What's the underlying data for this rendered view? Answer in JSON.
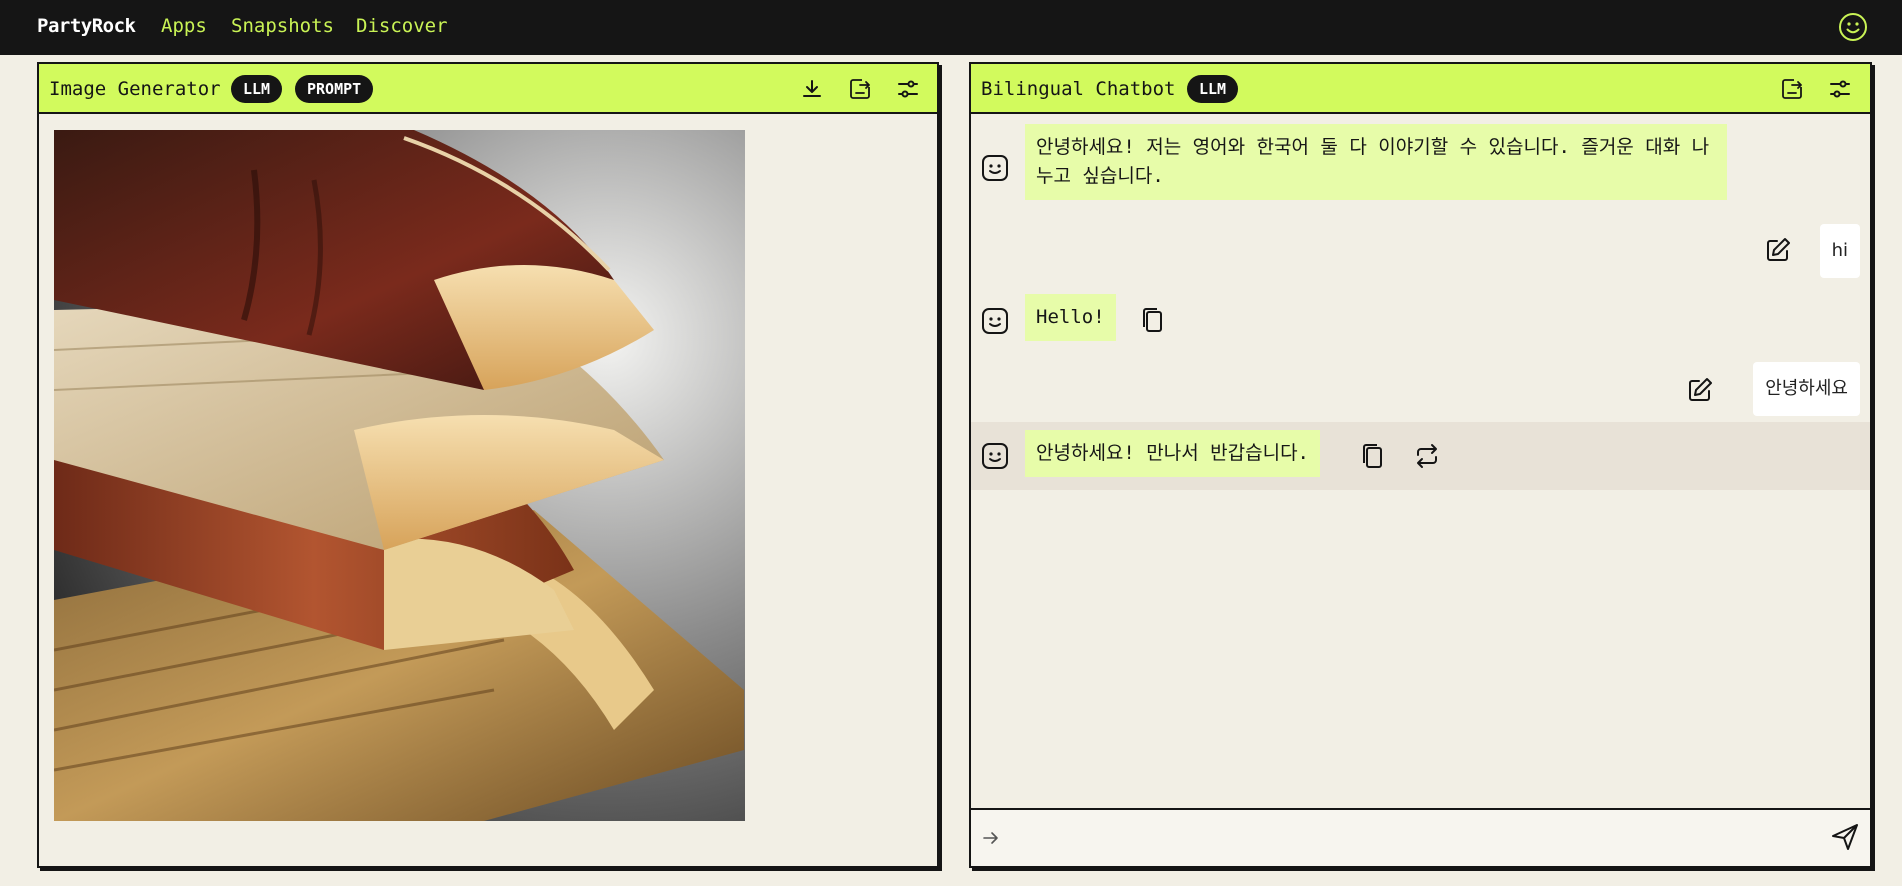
{
  "nav": {
    "brand": "PartyRock",
    "links": [
      "Apps",
      "Snapshots",
      "Discover"
    ],
    "user_icon": "smiley-icon"
  },
  "image_panel": {
    "title": "Image Generator",
    "badges": [
      "LLM",
      "PROMPT"
    ],
    "actions": [
      "download-icon",
      "share-icon",
      "settings-sliders-icon"
    ],
    "image_alt": "stack of old leather-bound books"
  },
  "chat_panel": {
    "title": "Bilingual Chatbot",
    "badges": [
      "LLM"
    ],
    "actions": [
      "share-icon",
      "settings-sliders-icon"
    ],
    "messages": [
      {
        "role": "bot",
        "text": "안녕하세요! 저는 영어와 한국어 둘 다 이야기할 수 있습니다. 즐거운 대화 나누고 싶습니다."
      },
      {
        "role": "user",
        "text": "hi"
      },
      {
        "role": "bot",
        "text": "Hello!"
      },
      {
        "role": "user",
        "text": "안녕하세요"
      },
      {
        "role": "bot",
        "text": "안녕하세요! 만나서 반갑습니다."
      }
    ],
    "input_placeholder": ""
  },
  "colors": {
    "accent": "#d2fa5d",
    "bot_bubble": "#e7fca9",
    "nav_bg": "#151515",
    "nav_link": "#c9f355",
    "page_bg": "#f2efe5"
  }
}
